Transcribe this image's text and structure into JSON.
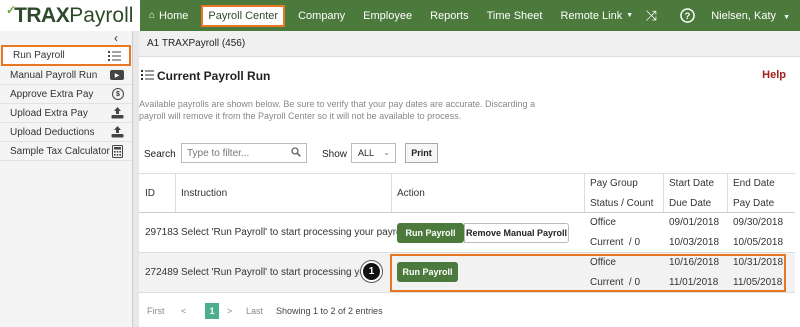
{
  "brand": {
    "logo_trax": "TRAX",
    "logo_payroll": "Payroll"
  },
  "nav": {
    "items": [
      {
        "label": "Home",
        "icon": "home-icon"
      },
      {
        "label": "Payroll Center"
      },
      {
        "label": "Company"
      },
      {
        "label": "Employee"
      },
      {
        "label": "Reports"
      },
      {
        "label": "Time Sheet"
      },
      {
        "label": "Remote Link"
      }
    ],
    "user": "Nielsen, Katy"
  },
  "sidebar": {
    "items": [
      {
        "label": "Run Payroll",
        "icon": "list-icon"
      },
      {
        "label": "Manual Payroll Run",
        "icon": "video-icon"
      },
      {
        "label": "Approve Extra Pay",
        "icon": "dollar-icon"
      },
      {
        "label": "Upload Extra Pay",
        "icon": "upload-icon"
      },
      {
        "label": "Upload Deductions",
        "icon": "upload-icon"
      },
      {
        "label": "Sample Tax Calculator",
        "icon": "calculator-icon"
      }
    ]
  },
  "company": "A1 TRAXPayroll (456)",
  "page": {
    "title": "Current Payroll Run",
    "help": "Help",
    "description": "Available payrolls are shown below. Be sure to verify that your pay dates are accurate. Discarding a payroll will remove it from the Payroll Center so it will not be available to process."
  },
  "filters": {
    "search_label": "Search",
    "search_placeholder": "Type to filter...",
    "show_label": "Show",
    "show_value": "ALL",
    "print_label": "Print"
  },
  "table": {
    "headers": {
      "id": "ID",
      "instruction": "Instruction",
      "action": "Action",
      "pay_group": "Pay Group",
      "status_count": "Status / Count",
      "start_date": "Start Date",
      "due_date": "Due Date",
      "end_date": "End Date",
      "pay_date": "Pay Date"
    },
    "rows": [
      {
        "id": "297183",
        "instruction": "Select 'Run Payroll' to start processing your payroll.",
        "run_label": "Run Payroll",
        "remove_label": "Remove Manual Payroll",
        "pay_group": "Office",
        "status": "Current  / 0",
        "start_date": "09/01/2018",
        "due_date": "10/03/2018",
        "end_date": "09/30/2018",
        "pay_date": "10/05/2018"
      },
      {
        "id": "272489",
        "instruction": "Select 'Run Payroll' to start processing your p",
        "run_label": "Run Payroll",
        "pay_group": "Office",
        "status": "Current  / 0",
        "start_date": "10/16/2018",
        "due_date": "11/01/2018",
        "end_date": "10/31/2018",
        "pay_date": "11/05/2018"
      }
    ]
  },
  "callout": "1",
  "pager": {
    "first": "First",
    "prev": "<",
    "page": "1",
    "next": ">",
    "last": "Last",
    "summary": "Showing 1 to 2 of 2 entries"
  }
}
